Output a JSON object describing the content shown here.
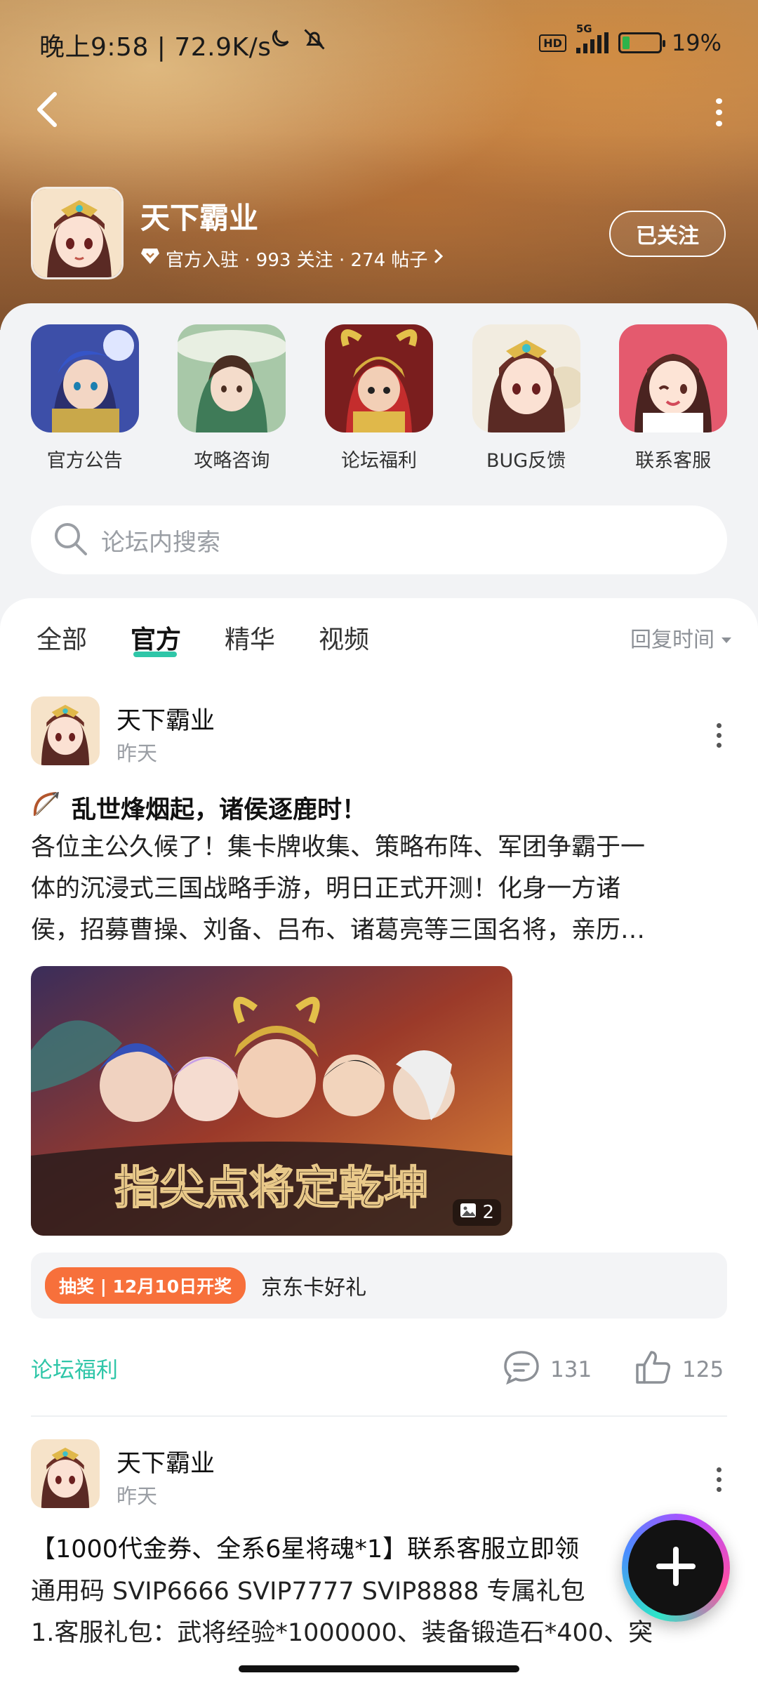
{
  "status_bar": {
    "time_speed": "晚上9:58 | 72.9K/s",
    "hd": "HD",
    "network": "5G",
    "battery": "19%"
  },
  "header": {
    "forum_title": "天下霸业",
    "meta": "官方入驻 · 993 关注 · 274 帖子",
    "follow_label": "已关注"
  },
  "categories": [
    {
      "label": "官方公告",
      "icon": "announcement-art"
    },
    {
      "label": "攻略咨询",
      "icon": "guide-art"
    },
    {
      "label": "论坛福利",
      "icon": "welfare-art"
    },
    {
      "label": "BUG反馈",
      "icon": "bug-feedback-art"
    },
    {
      "label": "联系客服",
      "icon": "customer-service-art"
    }
  ],
  "search": {
    "placeholder": "论坛内搜索"
  },
  "tabs": [
    {
      "label": "全部",
      "active": false
    },
    {
      "label": "官方",
      "active": true
    },
    {
      "label": "精华",
      "active": false
    },
    {
      "label": "视频",
      "active": false
    }
  ],
  "sort_label": "回复时间",
  "posts": [
    {
      "author": "天下霸业",
      "time": "昨天",
      "title": "乱世烽烟起，诸侯逐鹿时！",
      "body_lines": [
        "各位主公久候了！集卡牌收集、策略布阵、军团争霸于一",
        "体的沉浸式三国战略手游，明日正式开测！化身一方诸",
        "侯，招募曹操、刘备、吕布、诸葛亮等三国名将，亲历…"
      ],
      "image_count": "2",
      "image_caption": "指尖点将定乾坤",
      "lottery_tag": "抽奖 | 12月10日开奖",
      "lottery_text": "京东卡好礼",
      "board_tag": "论坛福利",
      "comments": "131",
      "likes": "125"
    },
    {
      "author": "天下霸业",
      "time": "昨天",
      "title": "【1000代金券、全系6星将魂*1】联系客服立即领",
      "body_lines": [
        "通用码 SVIP6666 SVIP7777 SVIP8888 专属礼包",
        "1.客服礼包：武将经验*1000000、装备锻造石*400、突"
      ]
    }
  ],
  "colors": {
    "accent": "#2fc6a8",
    "lottery": "#f7703b"
  }
}
